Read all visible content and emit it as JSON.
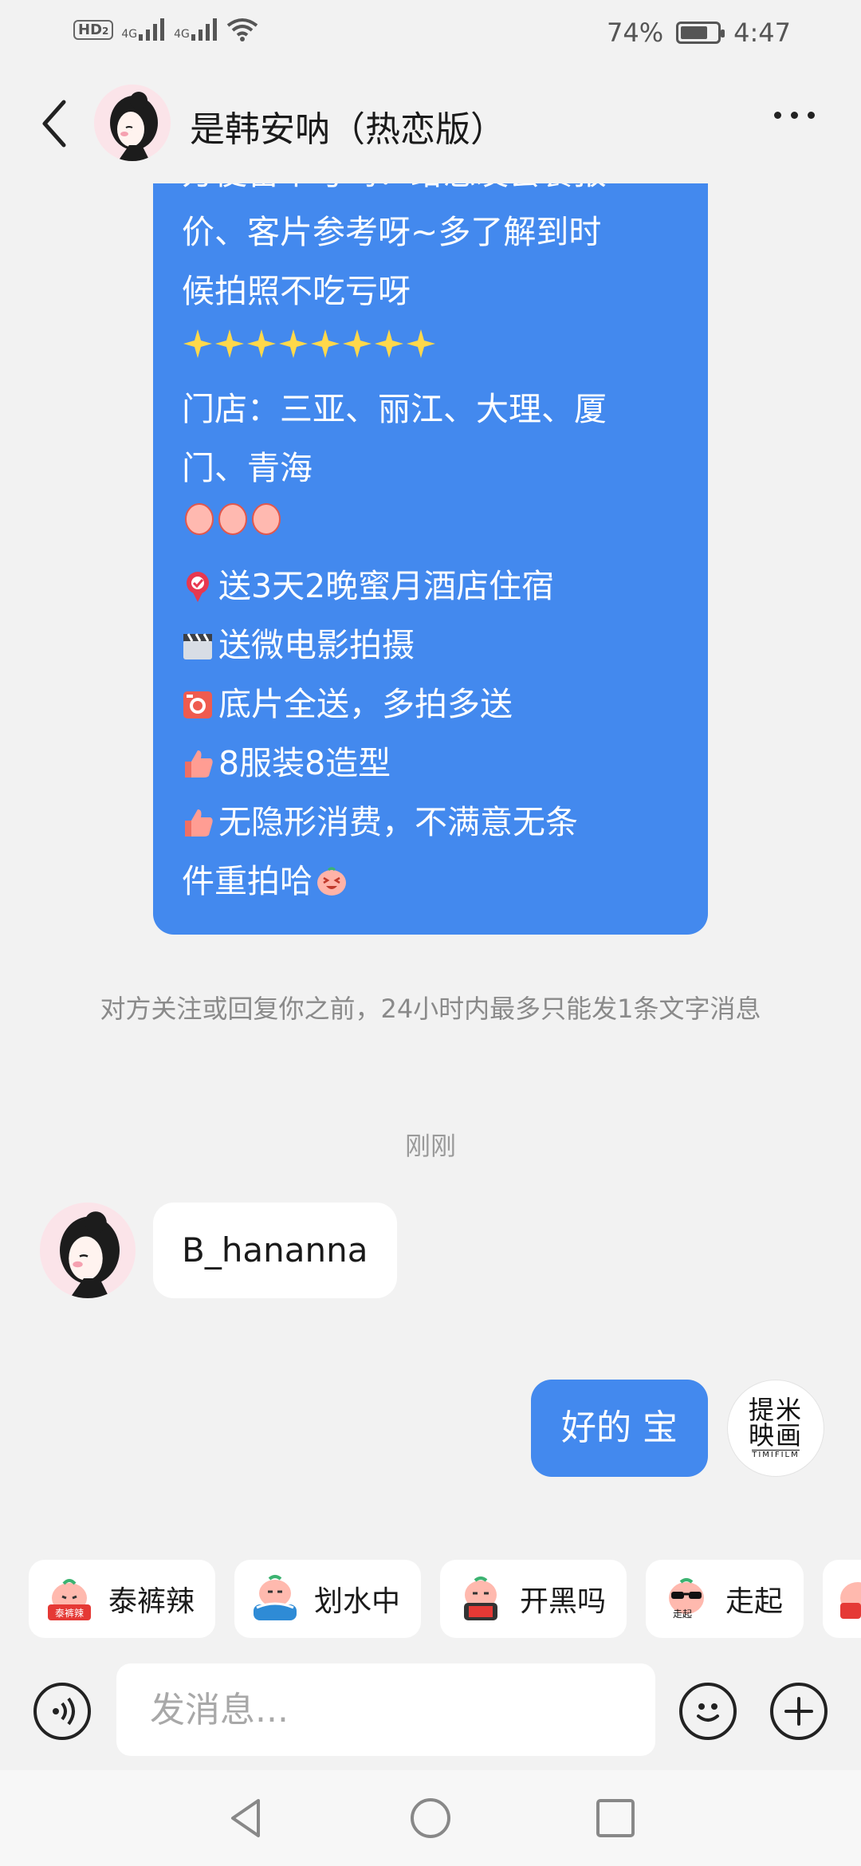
{
  "status_bar": {
    "hd_label": "HD",
    "hd_sub": "2",
    "net1": "4G",
    "net2": "4G",
    "battery_percent": "74%",
    "battery_level": 0.74,
    "time": "4:47"
  },
  "header": {
    "title": "是韩安呐（热恋版）"
  },
  "messages": {
    "big": {
      "lines": [
        "方便留个号吗？给您发套餐报",
        "价、客片参考呀~多了解到时",
        "候拍照不吃亏呀",
        "门店：三亚、丽江、大理、厦",
        "门、青海",
        "送3天2晚蜜月酒店住宿",
        "送微电影拍摄",
        "底片全送，多拍多送",
        "8服装8造型",
        "无隐形消费，不满意无条",
        "件重拍哈"
      ]
    },
    "notice": "对方关注或回复你之前，24小时内最多只能发1条文字消息",
    "time": "刚刚",
    "incoming": "B_hananna",
    "outgoing": "好的 宝"
  },
  "my_avatar": {
    "logo_cn": "提米映画",
    "logo_en": "TIMIFILM"
  },
  "quick_replies": [
    {
      "label": "泰裤辣",
      "sticker_text": "泰裤辣"
    },
    {
      "label": "划水中",
      "sticker_text": ""
    },
    {
      "label": "开黑吗",
      "sticker_text": ""
    },
    {
      "label": "走起",
      "sticker_text": "走起"
    }
  ],
  "input": {
    "placeholder": "发消息..."
  },
  "colors": {
    "bubble_blue": "#4389ee",
    "background": "#f2f2f2"
  }
}
